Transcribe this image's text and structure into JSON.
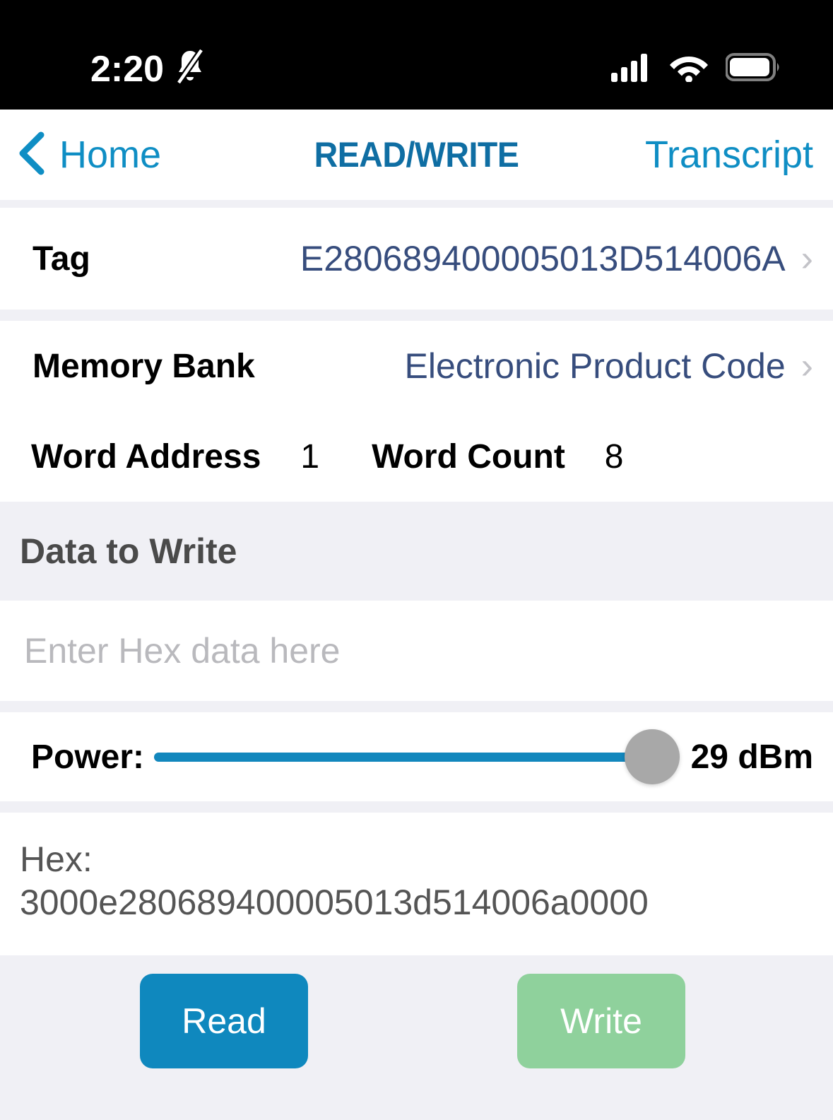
{
  "status_bar": {
    "time": "2:20",
    "mute_icon": "bell-slash-icon",
    "cellular_icon": "cellular-signal-icon",
    "wifi_icon": "wifi-icon",
    "battery_icon": "battery-icon"
  },
  "nav": {
    "back_label": "Home",
    "back_icon": "chevron-left-icon",
    "title": "READ/WRITE",
    "right_label": "Transcript",
    "accent_color": "#0f8ec4",
    "title_color": "#0f6ea3"
  },
  "tag": {
    "label": "Tag",
    "value": "E280689400005013D514006A",
    "chevron": "›"
  },
  "memory_bank": {
    "label": "Memory Bank",
    "value": "Electronic Product Code",
    "chevron": "›"
  },
  "word": {
    "address_label": "Word Address",
    "address_value": "1",
    "count_label": "Word Count",
    "count_value": "8"
  },
  "data_to_write": {
    "header": "Data to Write",
    "input_value": "",
    "input_placeholder": "Enter Hex data here"
  },
  "power": {
    "label": "Power:",
    "value_text": "29 dBm",
    "value": 29,
    "min": 0,
    "max": 29,
    "fill_percent": 100,
    "track_color": "#1287bd",
    "thumb_color": "#a8a8a8"
  },
  "hex_output": {
    "label": "Hex:",
    "value": "3000e280689400005013d514006a0000",
    "text_color": "#555555"
  },
  "actions": {
    "read_label": "Read",
    "read_color": "#0f88be",
    "write_label": "Write",
    "write_color": "#8fd19c"
  }
}
